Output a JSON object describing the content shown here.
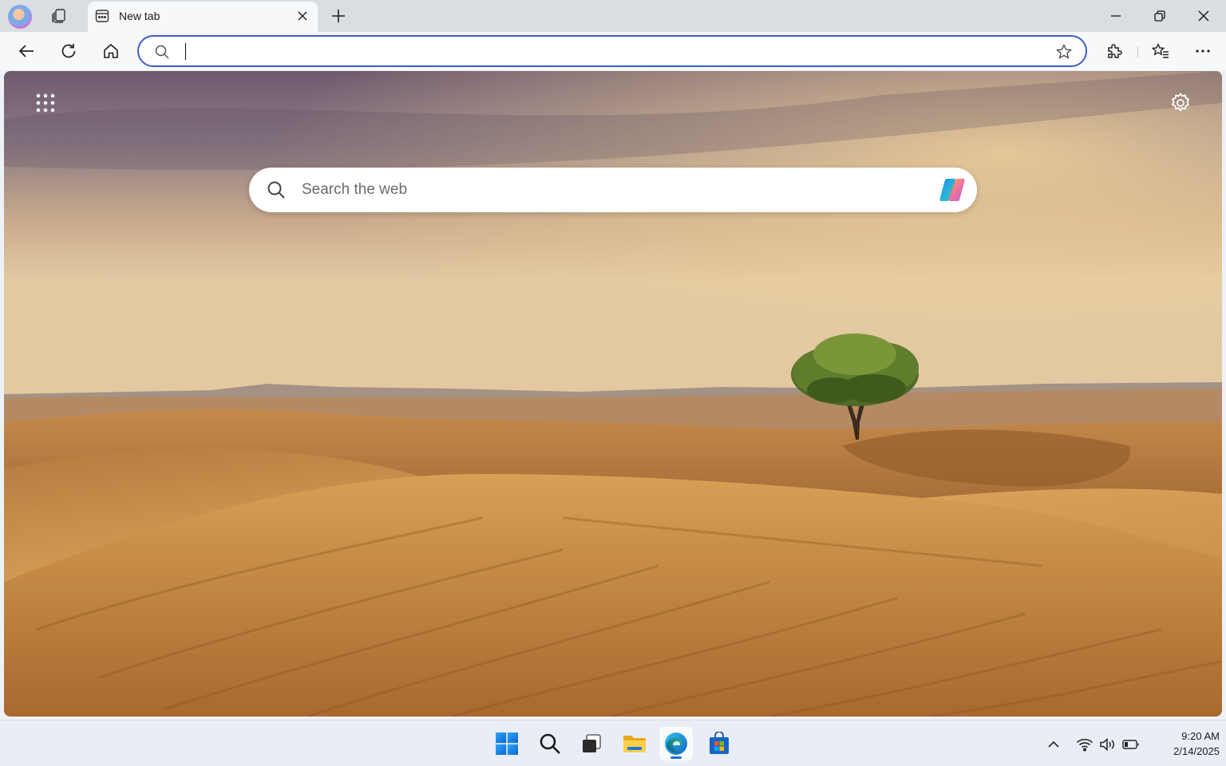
{
  "browser": {
    "tab": {
      "title": "New tab"
    },
    "address_bar": {
      "value": "",
      "placeholder": ""
    }
  },
  "new_tab_page": {
    "search": {
      "placeholder": "Search the web"
    },
    "background": "desert-dunes-with-lone-tree"
  },
  "taskbar": {
    "pinned": [
      "start-icon",
      "search-icon",
      "task-view-icon",
      "file-explorer-icon",
      "edge-icon",
      "store-icon"
    ],
    "active_app": "edge",
    "clock": {
      "time": "9:20 AM",
      "date": "2/14/2025"
    }
  },
  "colors": {
    "accent": "#3d5ec4",
    "tab_active": "#f7f8fa",
    "titlebar": "#dadde2",
    "taskbar": "#e9eef6"
  }
}
